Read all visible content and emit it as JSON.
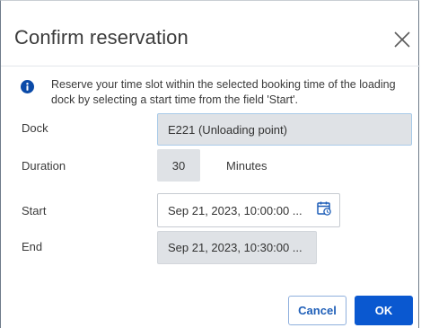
{
  "dialog": {
    "title": "Confirm reservation",
    "info_text": "Reserve your time slot within the selected booking time of the loading dock by selecting a start time from the field 'Start'."
  },
  "form": {
    "dock": {
      "label": "Dock",
      "value": "E221 (Unloading point)"
    },
    "duration": {
      "label": "Duration",
      "value": "30",
      "unit": "Minutes"
    },
    "start": {
      "label": "Start",
      "value": "Sep 21, 2023, 10:00:00 ..."
    },
    "end": {
      "label": "End",
      "value": "Sep 21, 2023, 10:30:00 ..."
    }
  },
  "buttons": {
    "cancel_label": "Cancel",
    "ok_label": "OK"
  },
  "colors": {
    "primary": "#0a58d0",
    "info_icon": "#0a4aa8",
    "readonly_field_bg": "#dfe2e6"
  },
  "icons": {
    "close": "close-icon",
    "info": "info-icon",
    "calendar": "calendar-icon"
  }
}
